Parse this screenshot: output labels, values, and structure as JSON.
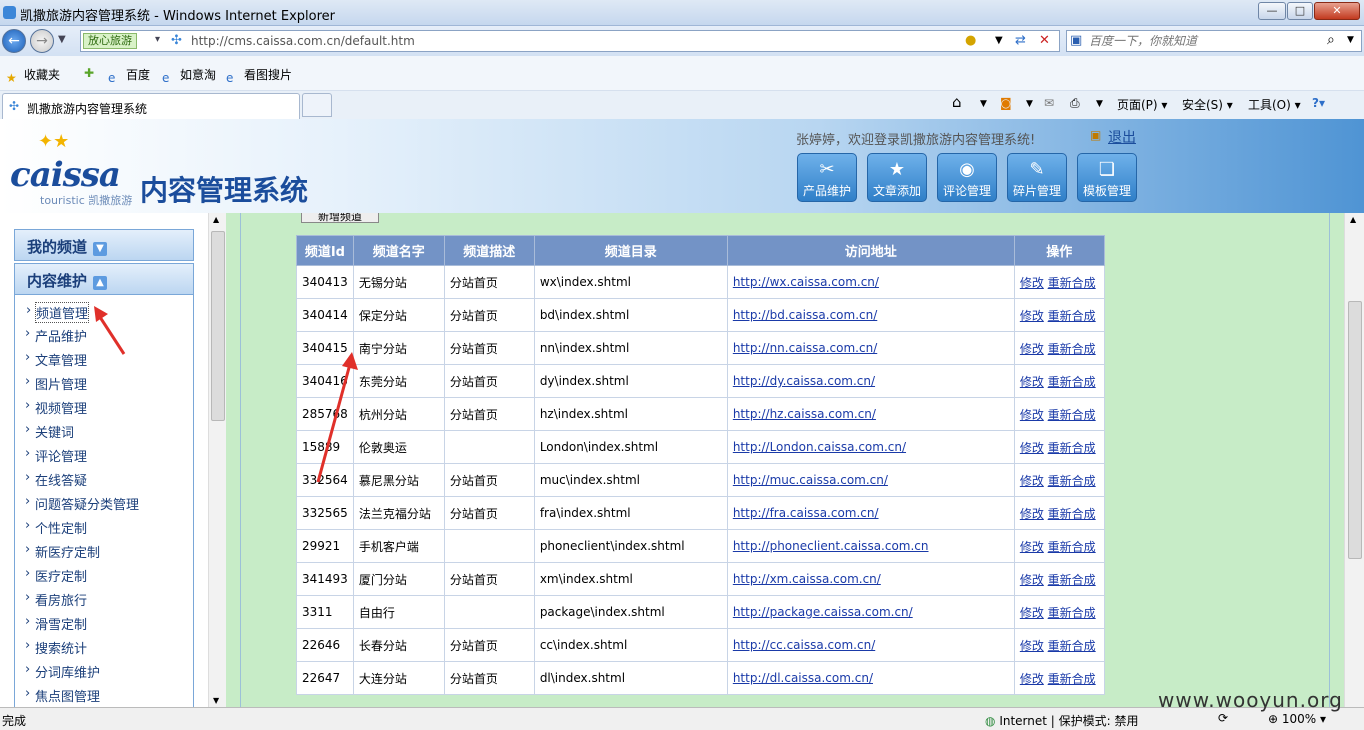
{
  "window": {
    "title": "凯撒旅游内容管理系统 - Windows Internet Explorer",
    "minimize": "—",
    "maximize": "□",
    "close": "✕"
  },
  "nav": {
    "safe_badge": "放心旅游",
    "url": "http://cms.caissa.com.cn/default.htm",
    "search_placeholder": "百度一下，你就知道"
  },
  "favbar": {
    "favorites": "收藏夹",
    "links": [
      "百度",
      "如意淘",
      "看图搜片"
    ]
  },
  "tab": {
    "title": "凯撒旅游内容管理系统"
  },
  "commandbar": {
    "page": "页面(P)",
    "safety": "安全(S)",
    "tools": "工具(O)"
  },
  "header": {
    "logo_text": "caissa",
    "logo_sub": "touristic 凯撒旅游",
    "system_title": "内容管理系统",
    "welcome": "张婷婷，欢迎登录凯撒旅游内容管理系统!",
    "logout": "退出",
    "buttons": [
      {
        "label": "产品维护",
        "icon": "tools-icon"
      },
      {
        "label": "文章添加",
        "icon": "star-icon"
      },
      {
        "label": "评论管理",
        "icon": "comment-icon"
      },
      {
        "label": "碎片管理",
        "icon": "notes-icon"
      },
      {
        "label": "模板管理",
        "icon": "template-icon"
      }
    ]
  },
  "sidebar": {
    "my_channels": "我的频道",
    "content_maint": "内容维护",
    "items": [
      "频道管理",
      "产品维护",
      "文章管理",
      "图片管理",
      "视频管理",
      "关键词",
      "评论管理",
      "在线答疑",
      "问题答疑分类管理",
      "个性定制",
      "新医疗定制",
      "医疗定制",
      "看房旅行",
      "滑雪定制",
      "搜索统计",
      "分词库维护",
      "焦点图管理"
    ]
  },
  "main": {
    "add_button": "新增频道",
    "columns": [
      "频道Id",
      "频道名字",
      "频道描述",
      "频道目录",
      "访问地址",
      "操作"
    ],
    "edit_label": "修改",
    "rebuild_label": "重新合成",
    "rows": [
      {
        "id": "340413",
        "name": "无锡分站",
        "desc": "分站首页",
        "dir": "wx\\index.shtml",
        "url": "http://wx.caissa.com.cn/"
      },
      {
        "id": "340414",
        "name": "保定分站",
        "desc": "分站首页",
        "dir": "bd\\index.shtml",
        "url": "http://bd.caissa.com.cn/"
      },
      {
        "id": "340415",
        "name": "南宁分站",
        "desc": "分站首页",
        "dir": "nn\\index.shtml",
        "url": "http://nn.caissa.com.cn/"
      },
      {
        "id": "340416",
        "name": "东莞分站",
        "desc": "分站首页",
        "dir": "dy\\index.shtml",
        "url": "http://dy.caissa.com.cn/"
      },
      {
        "id": "285768",
        "name": "杭州分站",
        "desc": "分站首页",
        "dir": "hz\\index.shtml",
        "url": "http://hz.caissa.com.cn/"
      },
      {
        "id": "15889",
        "name": "伦敦奥运",
        "desc": "",
        "dir": "London\\index.shtml",
        "url": "http://London.caissa.com.cn/"
      },
      {
        "id": "332564",
        "name": "慕尼黑分站",
        "desc": "分站首页",
        "dir": "muc\\index.shtml",
        "url": "http://muc.caissa.com.cn/"
      },
      {
        "id": "332565",
        "name": "法兰克福分站",
        "desc": "分站首页",
        "dir": "fra\\index.shtml",
        "url": "http://fra.caissa.com.cn/"
      },
      {
        "id": "29921",
        "name": "手机客户端",
        "desc": "",
        "dir": "phoneclient\\index.shtml",
        "url": "http://phoneclient.caissa.com.cn"
      },
      {
        "id": "341493",
        "name": "厦门分站",
        "desc": "分站首页",
        "dir": "xm\\index.shtml",
        "url": "http://xm.caissa.com.cn/"
      },
      {
        "id": "3311",
        "name": "自由行",
        "desc": "",
        "dir": "package\\index.shtml",
        "url": "http://package.caissa.com.cn/"
      },
      {
        "id": "22646",
        "name": "长春分站",
        "desc": "分站首页",
        "dir": "cc\\index.shtml",
        "url": "http://cc.caissa.com.cn/"
      },
      {
        "id": "22647",
        "name": "大连分站",
        "desc": "分站首页",
        "dir": "dl\\index.shtml",
        "url": "http://dl.caissa.com.cn/"
      }
    ]
  },
  "status": {
    "text": "完成",
    "zone": "Internet | 保护模式: 禁用",
    "zoom": "100%"
  },
  "watermark": "www.wooyun.org",
  "colors": {
    "table_header": "#7393c6",
    "main_bg": "#c7ecc7",
    "link": "#1a3aa8",
    "annotation_arrow": "#e0302a"
  }
}
